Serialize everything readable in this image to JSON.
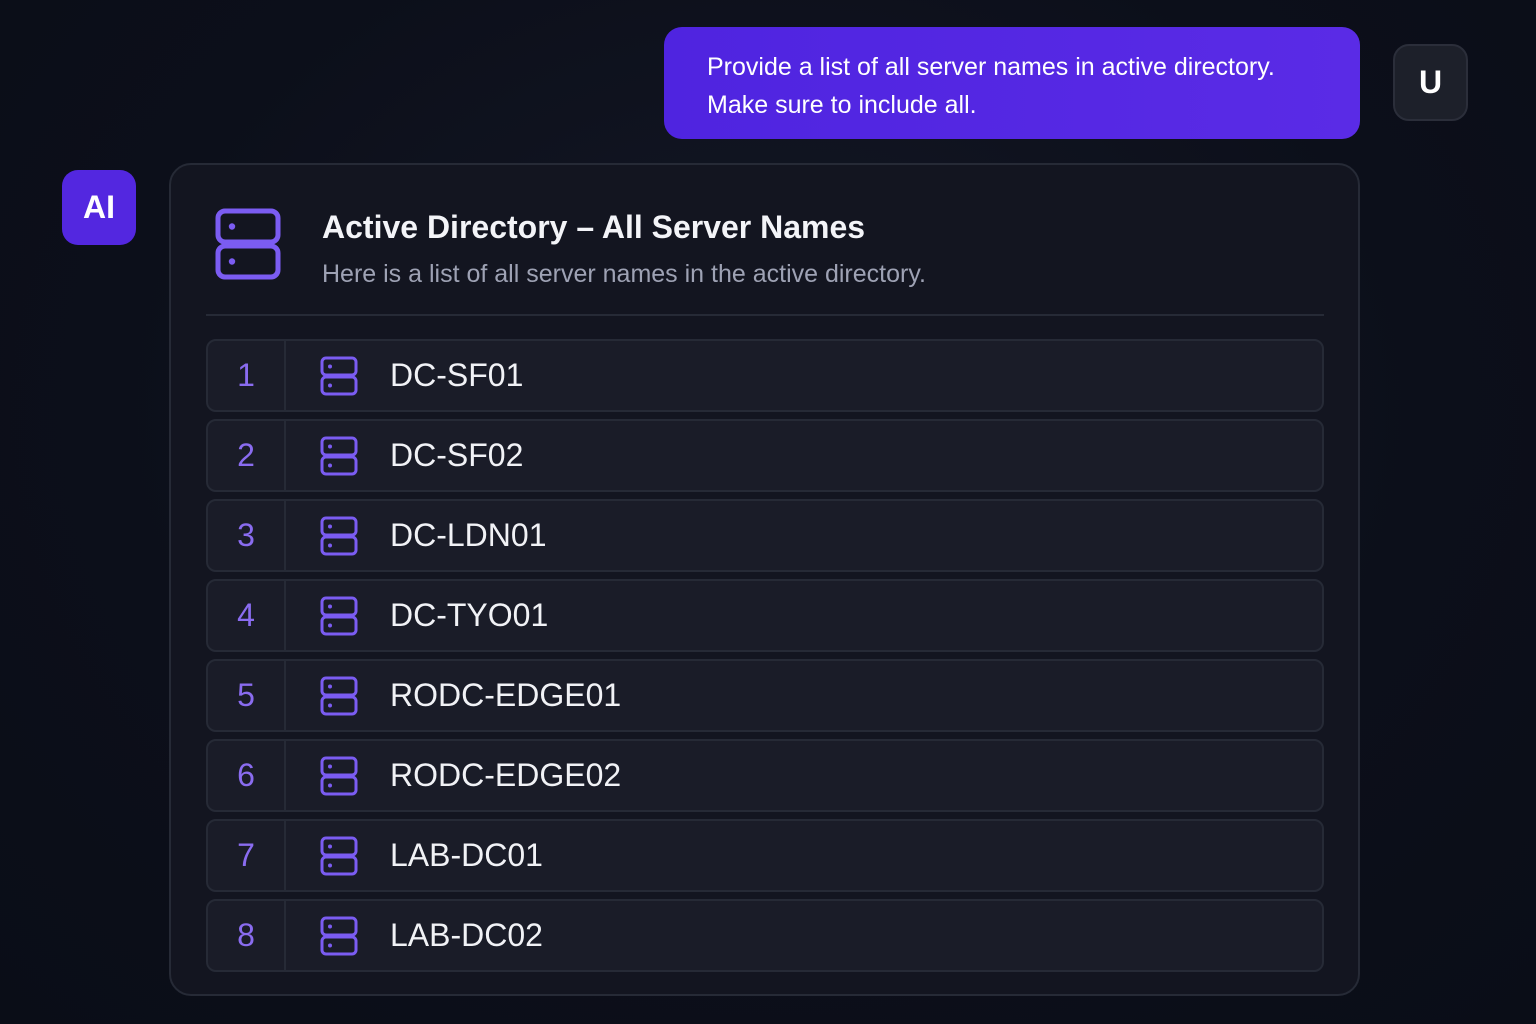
{
  "user_message": {
    "line1": "Provide a list of all server names in active directory.",
    "line2": "Make sure to include all.",
    "avatar_label": "U"
  },
  "assistant": {
    "avatar_label": "AI",
    "card": {
      "icon": "server-icon",
      "title": "Active Directory – All Server Names",
      "subtitle": "Here is a list of all server names in the active directory.",
      "servers": [
        {
          "index": "1",
          "name": "DC-SF01"
        },
        {
          "index": "2",
          "name": "DC-SF02"
        },
        {
          "index": "3",
          "name": "DC-LDN01"
        },
        {
          "index": "4",
          "name": "DC-TYO01"
        },
        {
          "index": "5",
          "name": "RODC-EDGE01"
        },
        {
          "index": "6",
          "name": "RODC-EDGE02"
        },
        {
          "index": "7",
          "name": "LAB-DC01"
        },
        {
          "index": "8",
          "name": "LAB-DC02"
        }
      ]
    }
  },
  "colors": {
    "accent": "#5a2be6",
    "accent_icon": "#7b5cf2",
    "background": "#0c0f1a",
    "card": "#131520",
    "row": "#1a1c28"
  }
}
